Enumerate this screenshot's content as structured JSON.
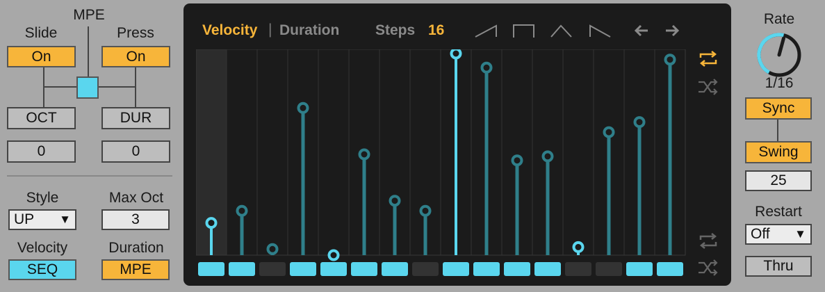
{
  "left": {
    "mpe_label": "MPE",
    "slide_label": "Slide",
    "slide_value": "On",
    "press_label": "Press",
    "press_value": "On",
    "oct_label": "OCT",
    "oct_value": "0",
    "dur_label": "DUR",
    "dur_value": "0",
    "style_label": "Style",
    "style_value": "UP",
    "maxoct_label": "Max Oct",
    "maxoct_value": "3",
    "velocity_label": "Velocity",
    "velocity_value": "SEQ",
    "duration_label": "Duration",
    "duration_value": "MPE"
  },
  "seq": {
    "tab_velocity": "Velocity",
    "tab_separator": "|",
    "tab_duration": "Duration",
    "steps_label": "Steps",
    "steps_value": "16",
    "shape_icons": [
      "ramp-up-icon",
      "square-icon",
      "triangle-icon",
      "ramp-down-icon"
    ],
    "velocity_values": [
      0.16,
      0.22,
      0.03,
      0.73,
      0.0,
      0.5,
      0.27,
      0.22,
      1.0,
      0.93,
      0.47,
      0.49,
      0.04,
      0.61,
      0.66,
      0.97
    ],
    "active_steps": [
      true,
      true,
      false,
      true,
      true,
      true,
      true,
      false,
      true,
      true,
      true,
      true,
      false,
      false,
      true,
      true
    ],
    "highlighted_steps": [
      0,
      4,
      8,
      12
    ],
    "colors": {
      "accent": "#f7b53a",
      "bar": "#2f7f8a",
      "bar_bright": "#5ad6ee",
      "step_on": "#5ad6ee",
      "step_off": "#333333"
    }
  },
  "right": {
    "rate_label": "Rate",
    "rate_value": "1/16",
    "sync_label": "Sync",
    "swing_label": "Swing",
    "swing_value": "25",
    "restart_label": "Restart",
    "restart_value": "Off",
    "thru_label": "Thru"
  }
}
